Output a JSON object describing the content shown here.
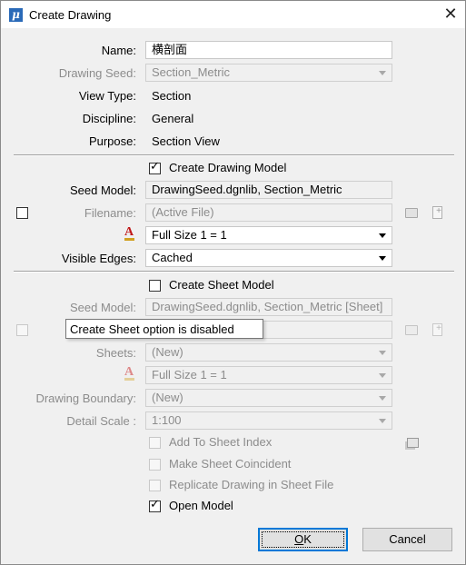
{
  "window": {
    "title": "Create Drawing",
    "close_glyph": "✕",
    "app_icon_glyph": "μ"
  },
  "fields": {
    "name_label": "Name:",
    "name_value": "横剖面",
    "drawing_seed_label": "Drawing Seed:",
    "drawing_seed_value": "Section_Metric",
    "view_type_label": "View Type:",
    "view_type_value": "Section",
    "discipline_label": "Discipline:",
    "discipline_value": "General",
    "purpose_label": "Purpose:",
    "purpose_value": "Section View"
  },
  "drawing_model": {
    "create_label": "Create Drawing Model",
    "create_checked": true,
    "seed_label": "Seed Model:",
    "seed_value": "DrawingSeed.dgnlib, Section_Metric",
    "filename_label": "Filename:",
    "filename_value": "(Active File)",
    "annotation_scale_value": "Full Size 1 = 1",
    "visible_edges_label": "Visible Edges:",
    "visible_edges_value": "Cached"
  },
  "sheet_model": {
    "create_label": "Create Sheet Model",
    "create_checked": false,
    "seed_label": "Seed Model:",
    "seed_value": "DrawingSeed.dgnlib, Section_Metric [Sheet]",
    "sheets_label": "Sheets:",
    "sheets_value": "(New)",
    "annotation_scale_value": "Full Size 1 = 1",
    "boundary_label": "Drawing Boundary:",
    "boundary_value": "(New)",
    "detail_scale_label": "Detail Scale :",
    "detail_scale_value": "1:100"
  },
  "options": {
    "add_to_index": "Add To Sheet Index",
    "make_coincident": "Make Sheet Coincident",
    "replicate": "Replicate Drawing in Sheet File",
    "open_model": "Open Model",
    "open_model_checked": true,
    "check_glyph": "✓"
  },
  "tooltip": "Create Sheet option is disabled",
  "buttons": {
    "ok_underlined": "O",
    "ok_rest": "K",
    "cancel": "Cancel"
  }
}
